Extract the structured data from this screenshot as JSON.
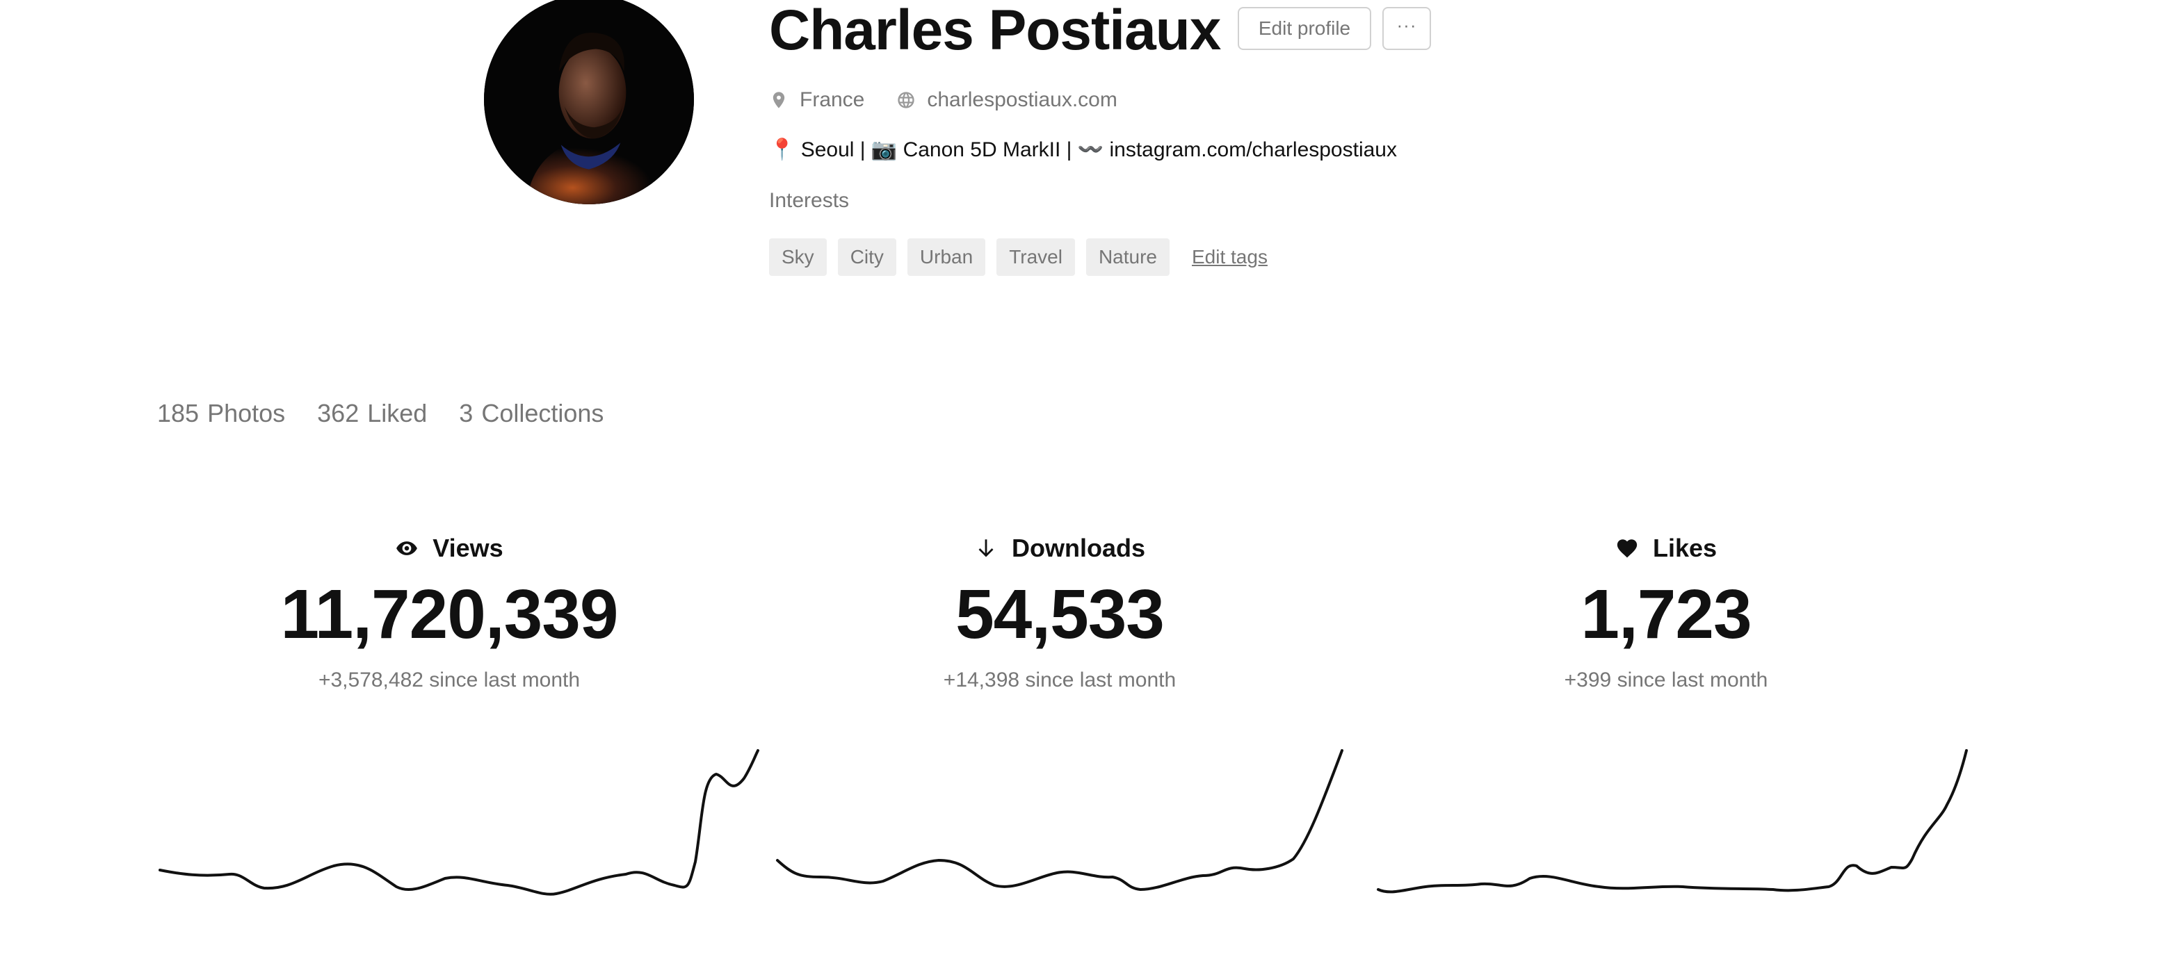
{
  "profile": {
    "name": "Charles Postiaux",
    "edit_profile_label": "Edit profile",
    "more_label": "···",
    "location": "France",
    "website": "charlespostiaux.com",
    "bio": "📍 Seoul | 📷 Canon 5D MarkII | 〰️ instagram.com/charlespostiaux",
    "interests_label": "Interests",
    "tags": [
      "Sky",
      "City",
      "Urban",
      "Travel",
      "Nature"
    ],
    "edit_tags_label": "Edit tags",
    "icons": {
      "location": "map-pin-icon",
      "website": "globe-icon"
    }
  },
  "tabs": [
    {
      "count": "185",
      "label": "Photos"
    },
    {
      "count": "362",
      "label": "Liked"
    },
    {
      "count": "3",
      "label": "Collections"
    }
  ],
  "stats": {
    "views": {
      "icon": "eye-icon",
      "label": "Views",
      "value": "11,720,339",
      "delta": "+3,578,482 since last month"
    },
    "downloads": {
      "icon": "arrow-down-icon",
      "label": "Downloads",
      "value": "54,533",
      "delta": "+14,398 since last month"
    },
    "likes": {
      "icon": "heart-icon",
      "label": "Likes",
      "value": "1,723",
      "delta": "+399 since last month"
    }
  },
  "colors": {
    "text": "#111111",
    "muted": "#767676",
    "tag_bg": "#eeeeee",
    "border": "#d1d1d1"
  }
}
